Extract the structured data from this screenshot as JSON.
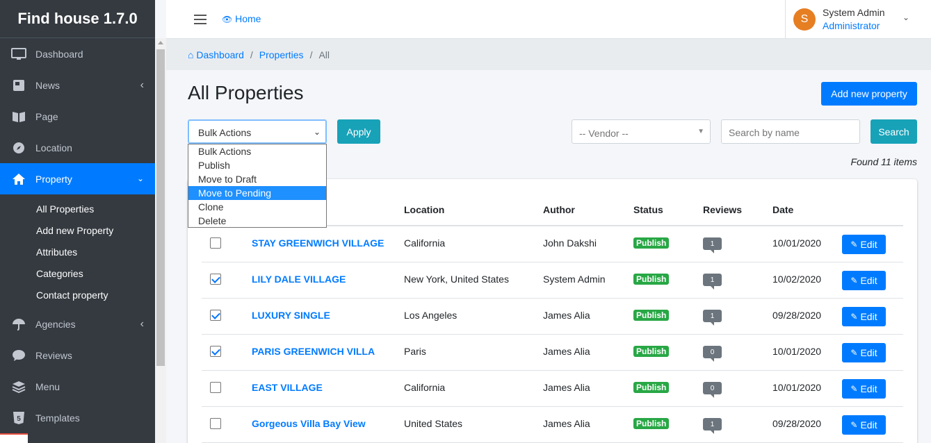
{
  "brand": {
    "title": "Find house 1.7.0"
  },
  "sidebar": {
    "items": [
      {
        "label": "Dashboard",
        "icon": "monitor-icon"
      },
      {
        "label": "News",
        "icon": "newspaper-icon"
      },
      {
        "label": "Page",
        "icon": "book-icon"
      },
      {
        "label": "Location",
        "icon": "compass-icon"
      },
      {
        "label": "Property",
        "icon": "home-icon"
      },
      {
        "label": "Agencies",
        "icon": "umbrella-icon"
      },
      {
        "label": "Reviews",
        "icon": "comment-icon"
      },
      {
        "label": "Menu",
        "icon": "layers-icon"
      },
      {
        "label": "Templates",
        "icon": "html5-icon"
      }
    ],
    "property_sub": [
      "All Properties",
      "Add new Property",
      "Attributes",
      "Categories",
      "Contact property"
    ]
  },
  "topbar": {
    "home_label": "Home",
    "user": {
      "initial": "S",
      "name": "System Admin",
      "role": "Administrator"
    }
  },
  "breadcrumb": {
    "items": [
      "Dashboard",
      "Properties",
      "All"
    ]
  },
  "main": {
    "title": "All Properties",
    "add_button": "Add new property",
    "bulk": {
      "selected": "Bulk Actions",
      "options": [
        "Bulk Actions",
        "Publish",
        "Move to Draft",
        "Move to Pending",
        "Clone",
        "Delete"
      ],
      "highlighted": "Move to Pending",
      "apply_label": "Apply"
    },
    "vendor_placeholder": "-- Vendor --",
    "search_placeholder": "Search by name",
    "search_label": "Search",
    "found_text": "Found 11 items"
  },
  "table": {
    "headers": {
      "location": "Location",
      "author": "Author",
      "status": "Status",
      "reviews": "Reviews",
      "date": "Date"
    },
    "edit_label": "Edit",
    "rows": [
      {
        "checked": false,
        "title": "STAY GREENWICH VILLAGE",
        "location": "California",
        "author": "John Dakshi",
        "status": "Publish",
        "reviews": "1",
        "date": "10/01/2020"
      },
      {
        "checked": true,
        "title": "LILY DALE VILLAGE",
        "location": "New York, United States",
        "author": "System Admin",
        "status": "Publish",
        "reviews": "1",
        "date": "10/02/2020"
      },
      {
        "checked": true,
        "title": "LUXURY SINGLE",
        "location": "Los Angeles",
        "author": "James Alia",
        "status": "Publish",
        "reviews": "1",
        "date": "09/28/2020"
      },
      {
        "checked": true,
        "title": "PARIS GREENWICH VILLA",
        "location": "Paris",
        "author": "James Alia",
        "status": "Publish",
        "reviews": "0",
        "date": "10/01/2020"
      },
      {
        "checked": false,
        "title": "EAST VILLAGE",
        "location": "California",
        "author": "James Alia",
        "status": "Publish",
        "reviews": "0",
        "date": "10/01/2020"
      },
      {
        "checked": false,
        "title": "Gorgeous Villa Bay View",
        "location": "United States",
        "author": "James Alia",
        "status": "Publish",
        "reviews": "1",
        "date": "09/28/2020"
      }
    ]
  },
  "colors": {
    "primary": "#007bff",
    "info": "#17a2b8",
    "success": "#28a745",
    "sidebar": "#343a40"
  }
}
